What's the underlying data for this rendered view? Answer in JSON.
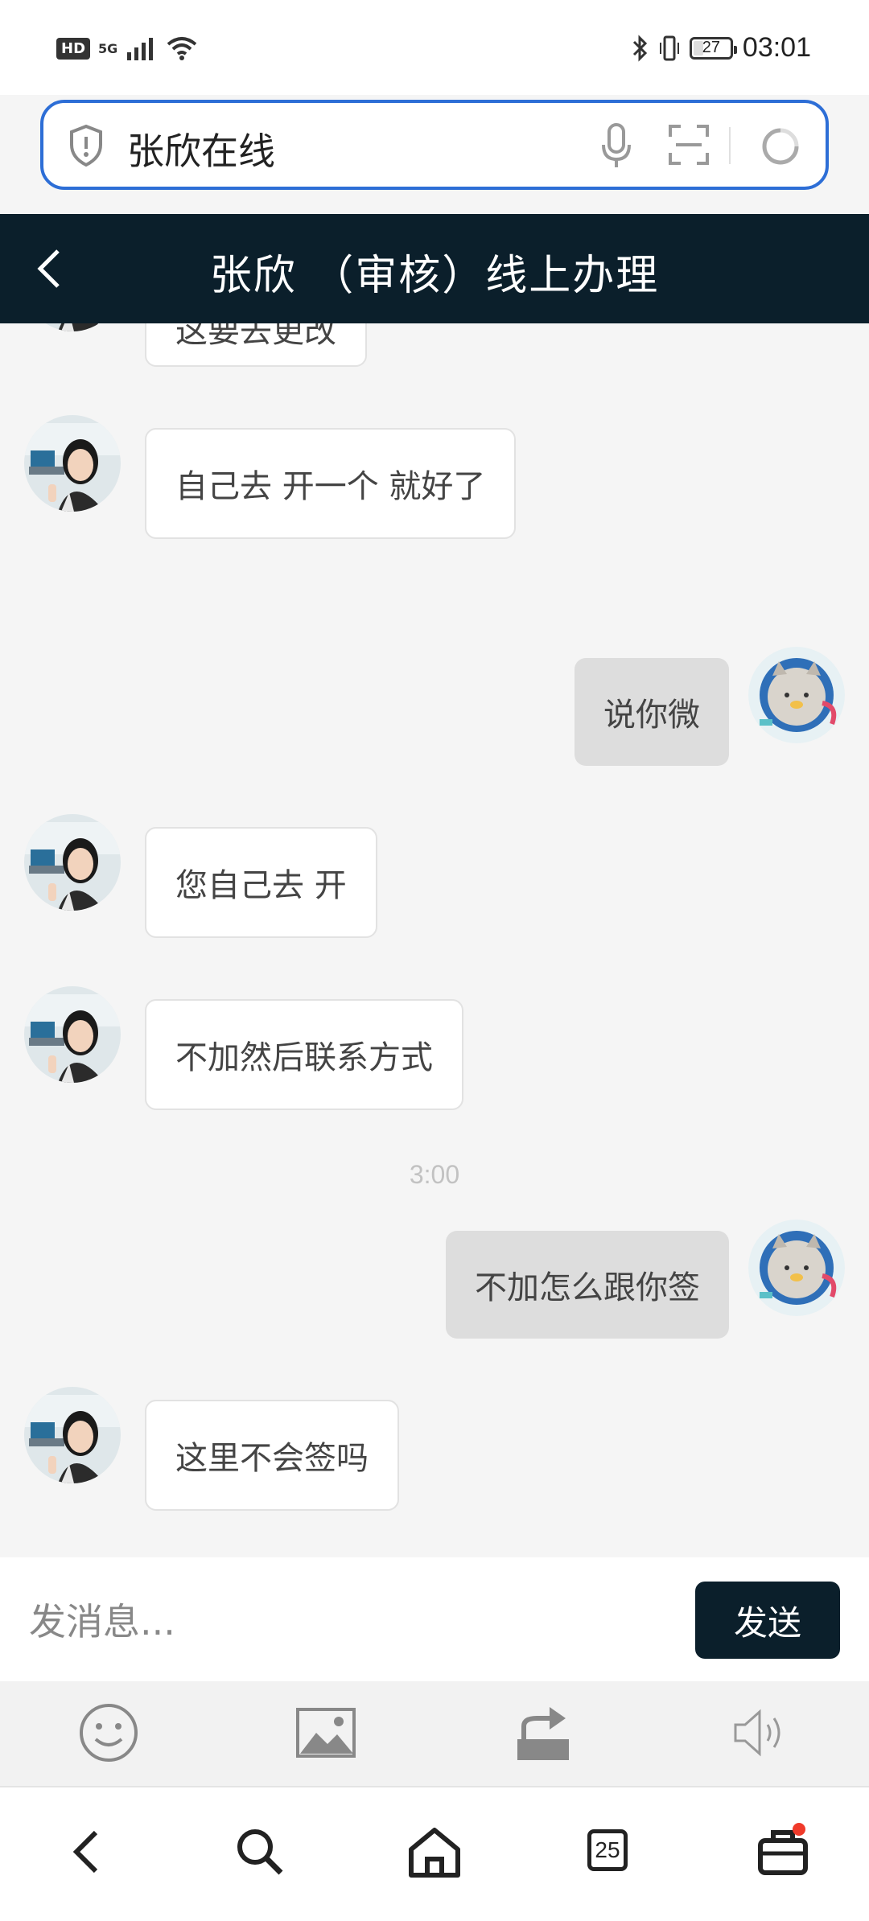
{
  "status_bar": {
    "hd": "HD",
    "network": "5G",
    "battery": "27",
    "battery_fraction": 0.27,
    "time": "03:01"
  },
  "search": {
    "query": "张欣在线"
  },
  "header": {
    "title": "张欣 （审核）线上办理"
  },
  "messages": [
    {
      "side": "in",
      "text": "这要去更改"
    },
    {
      "side": "in",
      "text": "自己去 开一个 就好了"
    },
    {
      "side": "out",
      "text": "说你微"
    },
    {
      "side": "in",
      "text": "您自己去 开"
    },
    {
      "side": "in",
      "text": "不加然后联系方式"
    },
    {
      "side": "out",
      "text": "不加怎么跟你签"
    },
    {
      "side": "in",
      "text": "这里不会签吗"
    }
  ],
  "time_label": "3:00",
  "input": {
    "placeholder": "发消息...",
    "send_label": "发送"
  },
  "nav": {
    "tab_count": "25"
  },
  "colors": {
    "accent": "#0b1f2b",
    "search_border": "#2d6ed6",
    "notification": "#f03a2a"
  }
}
